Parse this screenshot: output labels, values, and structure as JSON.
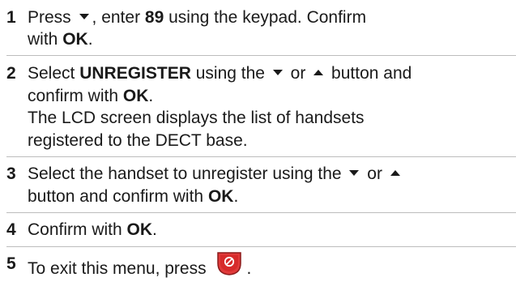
{
  "steps": [
    {
      "number": "1",
      "line1": {
        "a": "Press",
        "b": ", enter",
        "c": "89",
        "d": "using the keypad. Confirm"
      },
      "line2": {
        "a": "with",
        "b": "OK",
        "c": "."
      }
    },
    {
      "number": "2",
      "line1": {
        "a": "Select",
        "b": "UNREGISTER",
        "c": "using the",
        "d": "or",
        "e": "button and"
      },
      "line2": {
        "a": "confirm with",
        "b": "OK",
        "c": "."
      },
      "line3": "The LCD screen displays the list of handsets",
      "line4": "registered to the DECT base."
    },
    {
      "number": "3",
      "line1": {
        "a": "Select the handset to unregister using the",
        "b": "or"
      },
      "line2": {
        "a": "button and confirm with",
        "b": "OK",
        "c": "."
      }
    },
    {
      "number": "4",
      "line1": {
        "a": "Confirm with",
        "b": "OK",
        "c": "."
      }
    },
    {
      "number": "5",
      "line1": {
        "a": "To exit this menu, press",
        "b": "."
      }
    }
  ],
  "icons": {
    "nav_down": "down-arrow-icon",
    "nav_up": "up-arrow-icon",
    "end_key": "end-call-key-icon",
    "end_key_color": "#d62b2b"
  }
}
